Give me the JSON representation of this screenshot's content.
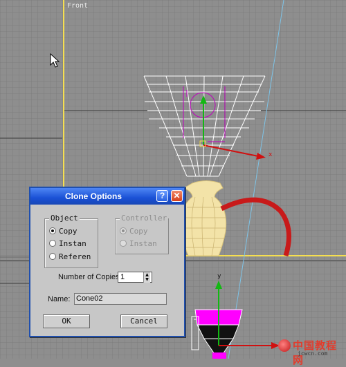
{
  "viewport": {
    "label": "Front",
    "cursor_icon": "arrow-cursor-icon",
    "axes": {
      "x_label": "x",
      "y_label": "y"
    },
    "colors": {
      "grid_bg": "#8e8e8e",
      "grid_line": "#7d7d7d",
      "active_border": "#f6df50",
      "wireframe": "#ffffff",
      "vase": "#f3e3a8",
      "handle": "#c81a1a",
      "gizmo_x": "#d01010",
      "gizmo_y": "#12b812",
      "selection": "#c000c0"
    }
  },
  "dialog": {
    "title": "Clone Options",
    "help_label": "?",
    "close_label": "✕",
    "object_group": {
      "label": "Object",
      "options": [
        {
          "label": "Copy",
          "selected": true
        },
        {
          "label": "Instan",
          "selected": false
        },
        {
          "label": "Referen",
          "selected": false
        }
      ]
    },
    "controller_group": {
      "label": "Controller",
      "options": [
        {
          "label": "Copy",
          "selected": true
        },
        {
          "label": "Instan",
          "selected": false
        }
      ]
    },
    "copies_label": "Number of Copies:",
    "copies_value": "1",
    "name_label": "Name:",
    "name_value": "Cone02",
    "ok_label": "OK",
    "cancel_label": "Cancel"
  },
  "watermark": {
    "text": "中国教程网",
    "url": "jcwcn.com"
  }
}
